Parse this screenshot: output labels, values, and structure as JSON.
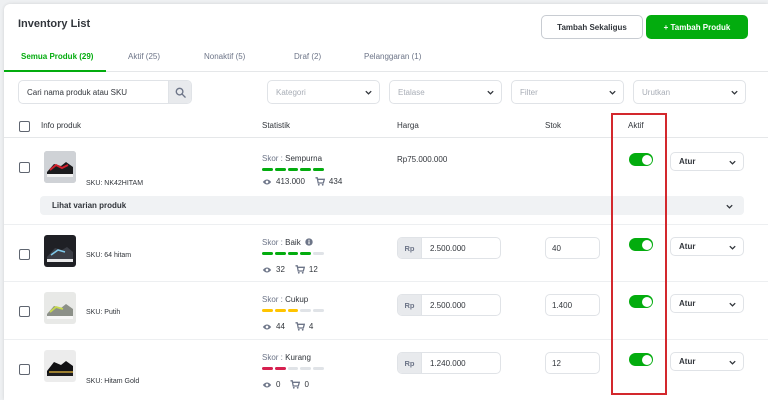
{
  "header": {
    "title": "Inventory List",
    "bulk_add_label": "Tambah Sekaligus",
    "add_product_label": "+ Tambah Produk"
  },
  "tabs": [
    {
      "label": "Semua Produk (29)",
      "active": true
    },
    {
      "label": "Aktif (25)",
      "active": false
    },
    {
      "label": "Nonaktif (5)",
      "active": false
    },
    {
      "label": "Draf (2)",
      "active": false
    },
    {
      "label": "Pelanggaran (1)",
      "active": false
    }
  ],
  "filters": {
    "search_placeholder": "Cari nama produk atau SKU",
    "kategori": "Kategori",
    "etalase": "Etalase",
    "filter": "Filter",
    "urutkan": "Urutkan"
  },
  "columns": {
    "info": "Info produk",
    "statistik": "Statistik",
    "harga": "Harga",
    "stok": "Stok",
    "aktif": "Aktif"
  },
  "products": [
    {
      "sku": "SKU: NK42HITAM",
      "score_prefix": "Skor : ",
      "score": "Sempurna",
      "score_level": 5,
      "score_color": "#03ac0e",
      "views": "413.000",
      "sold": "434",
      "price": "Rp75.000.000",
      "price_prefix": "",
      "stock": "",
      "active": true,
      "action": "Atur"
    },
    {
      "sku": "SKU: 64 hitam",
      "score_prefix": "Skor : ",
      "score": "Baik",
      "score_level": 4,
      "score_color": "#03ac0e",
      "views": "32",
      "sold": "12",
      "price": "2.500.000",
      "price_prefix": "Rp",
      "stock": "40",
      "active": true,
      "action": "Atur"
    },
    {
      "sku": "SKU: Putih",
      "score_prefix": "Skor : ",
      "score": "Cukup",
      "score_level": 3,
      "score_color": "#ffc400",
      "views": "44",
      "sold": "4",
      "price": "2.500.000",
      "price_prefix": "Rp",
      "stock": "1.400",
      "active": true,
      "action": "Atur"
    },
    {
      "sku": "SKU: Hitam Gold",
      "score_prefix": "Skor : ",
      "score": "Kurang",
      "score_level": 2,
      "score_color": "#d6204f",
      "views": "0",
      "sold": "0",
      "price": "1.240.000",
      "price_prefix": "Rp",
      "stock": "12",
      "active": true,
      "action": "Atur"
    }
  ],
  "variant_toggle": "Lihat varian produk",
  "colors": {
    "accent": "#03ac0e",
    "highlight": "#d3282d"
  },
  "icons": {
    "search": "search-icon",
    "chevron": "chevron-down-icon",
    "views": "eye-icon",
    "sold": "cart-icon",
    "info": "info-icon"
  }
}
